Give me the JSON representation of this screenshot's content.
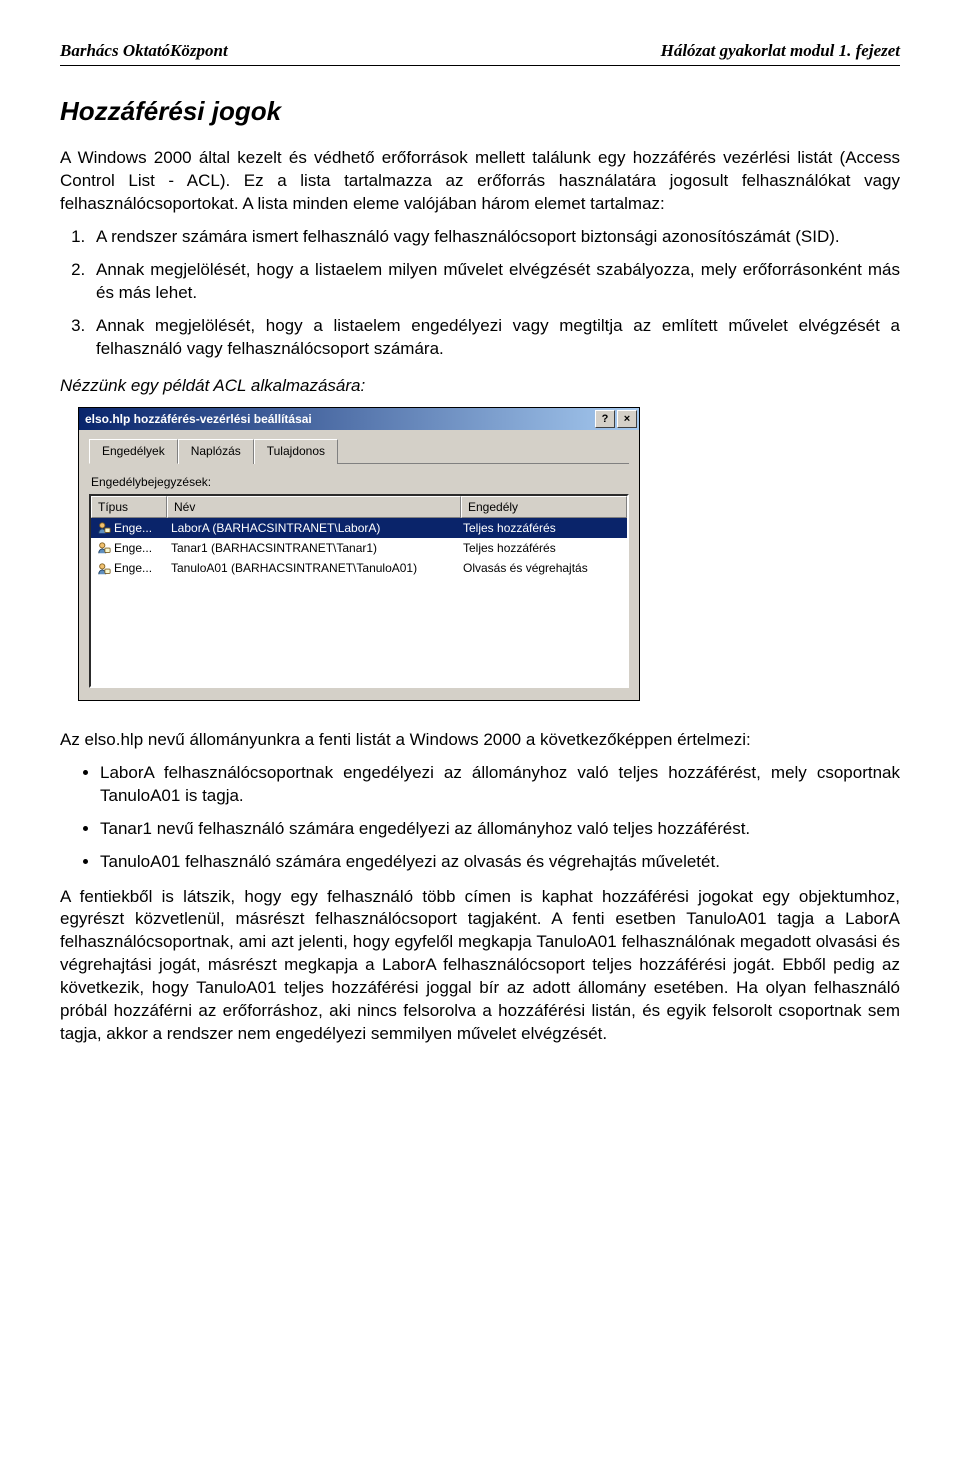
{
  "header": {
    "left": "Barhács OktatóKözpont",
    "right": "Hálózat gyakorlat modul 1. fejezet"
  },
  "section_title": "Hozzáférési jogok",
  "intro_p1": "A Windows 2000 által kezelt és védhető erőforrások mellett találunk egy hozzáférés vezérlési listát (Access Control List - ACL). Ez a lista tartalmazza az erőforrás használatára jogosult felhasználókat vagy felhasználócsoportokat. A lista minden eleme valójában három elemet tartalmaz:",
  "numlist": [
    "A rendszer számára ismert felhasználó vagy felhasználócsoport biztonsági azonosítószámát (SID).",
    "Annak megjelölését, hogy a listaelem milyen művelet elvégzését szabályozza, mely erőforrásonként más és más lehet.",
    "Annak megjelölését, hogy a listaelem engedélyezi vagy megtiltja az említett művelet elvégzését a felhasználó vagy felhasználócsoport számára."
  ],
  "example_label": "Nézzünk egy példát ACL alkalmazására:",
  "dialog": {
    "title": "elso.hlp hozzáférés-vezérlési beállításai",
    "help_btn": "?",
    "close_btn": "×",
    "tabs": [
      "Engedélyek",
      "Naplózás",
      "Tulajdonos"
    ],
    "list_label": "Engedélybejegyzések:",
    "columns": [
      "Típus",
      "Név",
      "Engedély"
    ],
    "rows": [
      {
        "type": "Enge...",
        "name": "LaborA (BARHACSINTRANET\\LaborA)",
        "perm": "Teljes hozzáférés",
        "selected": true
      },
      {
        "type": "Enge...",
        "name": "Tanar1 (BARHACSINTRANET\\Tanar1)",
        "perm": "Teljes hozzáférés",
        "selected": false
      },
      {
        "type": "Enge...",
        "name": "TanuloA01 (BARHACSINTRANET\\TanuloA01)",
        "perm": "Olvasás és végrehajtás",
        "selected": false
      }
    ]
  },
  "after_p1": "Az elso.hlp nevű állományunkra a fenti listát a Windows 2000 a következőképpen értelmezi:",
  "bullets": [
    "LaborA felhasználócsoportnak engedélyezi az állományhoz való teljes hozzáférést, mely csoportnak TanuloA01 is tagja.",
    "Tanar1 nevű felhasználó számára engedélyezi az állományhoz való teljes hozzáférést.",
    "TanuloA01 felhasználó számára engedélyezi az olvasás és végrehajtás műveletét."
  ],
  "after_p2": "A fentiekből is látszik, hogy egy felhasználó több címen is kaphat hozzáférési jogokat egy objektumhoz, egyrészt közvetlenül, másrészt felhasználócsoport tagjaként. A fenti esetben TanuloA01 tagja a LaborA felhasználócsoportnak, ami azt jelenti, hogy egyfelől megkapja TanuloA01 felhasználónak megadott olvasási és végrehajtási jogát, másrészt megkapja a LaborA felhasználócsoport teljes hozzáférési jogát. Ebből pedig az következik, hogy TanuloA01 teljes hozzáférési joggal bír az adott állomány esetében. Ha olyan felhasználó próbál hozzáférni az erőforráshoz, aki nincs felsorolva a hozzáférési listán, és egyik felsorolt csoportnak sem tagja, akkor a rendszer nem engedélyezi semmilyen művelet elvégzését."
}
